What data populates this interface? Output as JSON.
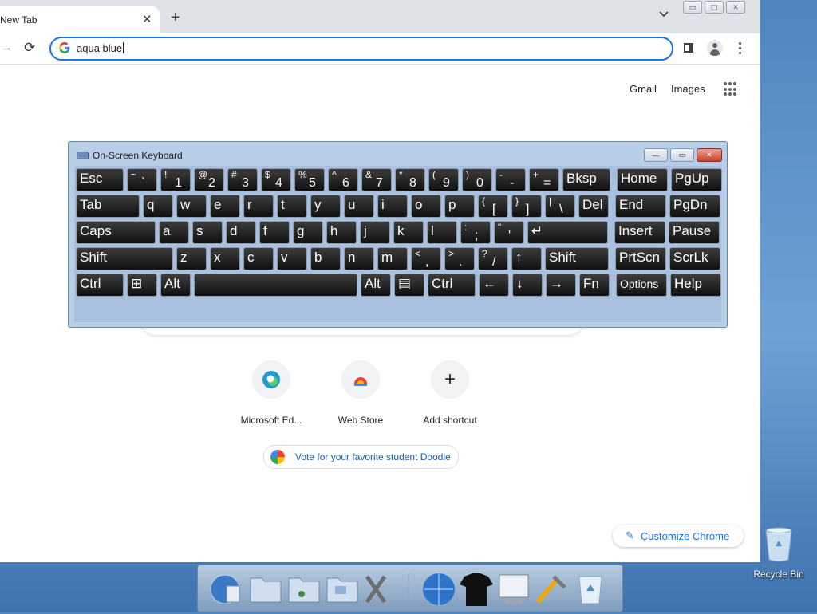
{
  "browser": {
    "tab_title": "New Tab",
    "tab_close": "✕",
    "new_tab": "+",
    "tab_list": "⌄",
    "window_controls": [
      "▭",
      "▢",
      "✕"
    ],
    "omnibox_value": "aqua blue"
  },
  "ntp": {
    "links": [
      "Gmail",
      "Images"
    ],
    "shortcuts": [
      {
        "label": "Microsoft Ed...",
        "icon": "edge-icon"
      },
      {
        "label": "Web Store",
        "icon": "chrome-web-store-icon"
      },
      {
        "label": "Add shortcut",
        "icon": "plus-icon",
        "glyph": "+"
      }
    ],
    "doodle_chip": "Vote for your favorite student Doodle",
    "customize": "Customize Chrome"
  },
  "osk": {
    "title": "On-Screen Keyboard",
    "controls": [
      "—",
      "▭",
      "✕"
    ],
    "rows": [
      [
        {
          "label": "Esc"
        },
        {
          "shift": "~",
          "main": "`"
        },
        {
          "shift": "!",
          "main": "1"
        },
        {
          "shift": "@",
          "main": "2"
        },
        {
          "shift": "#",
          "main": "3"
        },
        {
          "shift": "$",
          "main": "4"
        },
        {
          "shift": "%",
          "main": "5"
        },
        {
          "shift": "^",
          "main": "6"
        },
        {
          "shift": "&",
          "main": "7"
        },
        {
          "shift": "*",
          "main": "8"
        },
        {
          "shift": "(",
          "main": "9"
        },
        {
          "shift": ")",
          "main": "0"
        },
        {
          "shift": "-",
          "main": "-"
        },
        {
          "shift": "+",
          "main": "="
        },
        {
          "label": "Bksp"
        },
        {
          "label": "Home"
        },
        {
          "label": "PgUp"
        }
      ],
      [
        {
          "label": "Tab"
        },
        {
          "label": "q"
        },
        {
          "label": "w"
        },
        {
          "label": "e"
        },
        {
          "label": "r"
        },
        {
          "label": "t"
        },
        {
          "label": "y"
        },
        {
          "label": "u"
        },
        {
          "label": "i"
        },
        {
          "label": "o"
        },
        {
          "label": "p"
        },
        {
          "shift": "{",
          "main": "["
        },
        {
          "shift": "}",
          "main": "]"
        },
        {
          "shift": "|",
          "main": "\\"
        },
        {
          "label": "Del"
        },
        {
          "label": "End"
        },
        {
          "label": "PgDn"
        }
      ],
      [
        {
          "label": "Caps"
        },
        {
          "label": "a"
        },
        {
          "label": "s"
        },
        {
          "label": "d"
        },
        {
          "label": "f"
        },
        {
          "label": "g"
        },
        {
          "label": "h"
        },
        {
          "label": "j"
        },
        {
          "label": "k"
        },
        {
          "label": "l"
        },
        {
          "shift": ":",
          "main": ";"
        },
        {
          "shift": "\"",
          "main": "'"
        },
        {
          "label": "↵"
        },
        {
          "label": "Insert"
        },
        {
          "label": "Pause"
        }
      ],
      [
        {
          "label": "Shift"
        },
        {
          "label": "z"
        },
        {
          "label": "x"
        },
        {
          "label": "c"
        },
        {
          "label": "v"
        },
        {
          "label": "b"
        },
        {
          "label": "n"
        },
        {
          "label": "m"
        },
        {
          "shift": "<",
          "main": ","
        },
        {
          "shift": ">",
          "main": "."
        },
        {
          "shift": "?",
          "main": "/"
        },
        {
          "label": "↑"
        },
        {
          "label": "Shift"
        },
        {
          "label": "PrtScn"
        },
        {
          "label": "ScrLk"
        }
      ],
      [
        {
          "label": "Ctrl"
        },
        {
          "label": "⊞"
        },
        {
          "label": "Alt"
        },
        {
          "label": ""
        },
        {
          "label": "Alt"
        },
        {
          "label": "▤"
        },
        {
          "label": "Ctrl"
        },
        {
          "label": "←"
        },
        {
          "label": "↓"
        },
        {
          "label": "→"
        },
        {
          "label": "Fn"
        },
        {
          "label": "Options"
        },
        {
          "label": "Help"
        }
      ]
    ]
  },
  "desktop": {
    "recycle_bin": "Recycle Bin",
    "dock_icons": [
      "globe-icon",
      "folder-icon",
      "music-folder-icon",
      "picture-folder-icon",
      "tools-icon",
      "internet-globe-icon",
      "tshirt-icon",
      "monitor-icon",
      "utilities-icon",
      "recycle-trash-icon"
    ]
  }
}
